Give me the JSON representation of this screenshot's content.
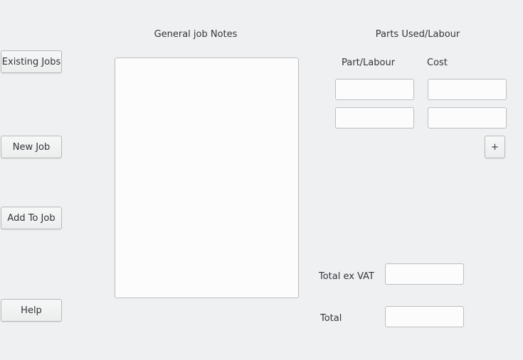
{
  "sidebar": {
    "existing_jobs_label": "Existing Jobs",
    "new_job_label": "New Job",
    "add_to_job_label": "Add To Job",
    "help_label": "Help"
  },
  "notes": {
    "title": "General job Notes",
    "value": ""
  },
  "parts": {
    "title": "Parts Used/Labour",
    "col_part": "Part/Labour",
    "col_cost": "Cost",
    "rows": [
      {
        "part": "",
        "cost": ""
      },
      {
        "part": "",
        "cost": ""
      }
    ],
    "add_row_label": "+"
  },
  "totals": {
    "ex_vat_label": "Total ex VAT",
    "ex_vat_value": "",
    "total_label": "Total",
    "total_value": ""
  }
}
